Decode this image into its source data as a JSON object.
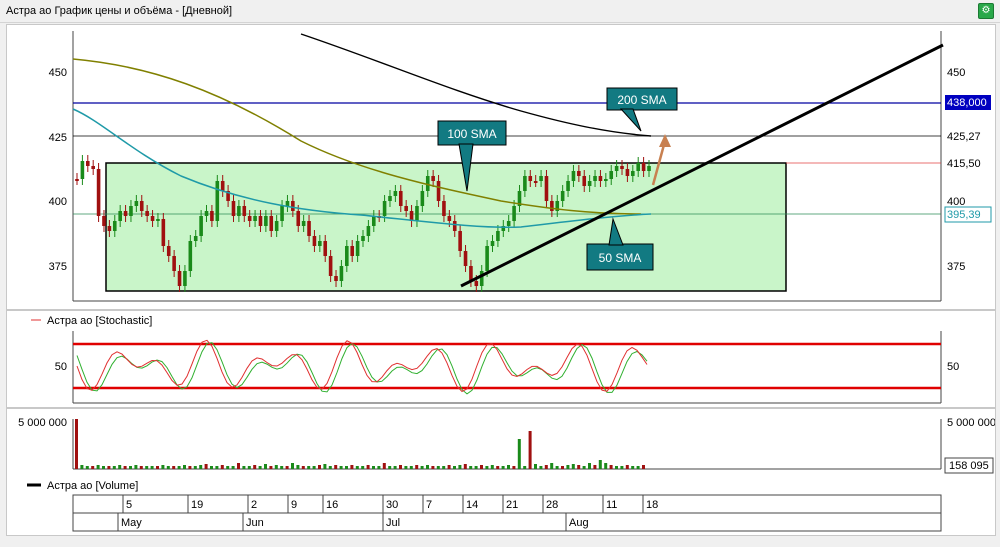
{
  "window": {
    "title": "Астра ао График цены и объёма - [Дневной]",
    "icon": "chart-settings-icon"
  },
  "price_chart": {
    "y_ticks": [
      "450",
      "425",
      "400",
      "375"
    ],
    "right_ticks": [
      "450",
      "400",
      "375"
    ],
    "price_tags": {
      "sma200": "438,000",
      "line_425": "425,27",
      "last": "415,50",
      "sma50": "395,39"
    },
    "callouts": {
      "sma200": "200 SMA",
      "sma100": "100 SMA",
      "sma50": "50 SMA"
    },
    "colors": {
      "range_fill": "#c9f5c9",
      "sma200": "#000000",
      "sma100": "#808000",
      "sma50": "#1f9aa8",
      "level_line": "#0000a0",
      "callout": "#127a82",
      "up_candle": "#1a8a1a",
      "down_candle": "#a01010"
    }
  },
  "stoch_chart": {
    "legend": "Астра ао [Stochastic]",
    "y_tick": "50",
    "colors": {
      "k": "#e03030",
      "d": "#30b030",
      "bounds": "#e00000"
    }
  },
  "volume_chart": {
    "y_tick": "5 000 000",
    "last_tag": "158 095",
    "legend": "Астра ао [Volume]"
  },
  "time_axis": {
    "days": [
      "5",
      "19",
      "2",
      "9",
      "16",
      "30",
      "7",
      "14",
      "21",
      "28",
      "11",
      "18"
    ],
    "months": [
      "May",
      "Jun",
      "Jul",
      "Aug"
    ]
  }
}
